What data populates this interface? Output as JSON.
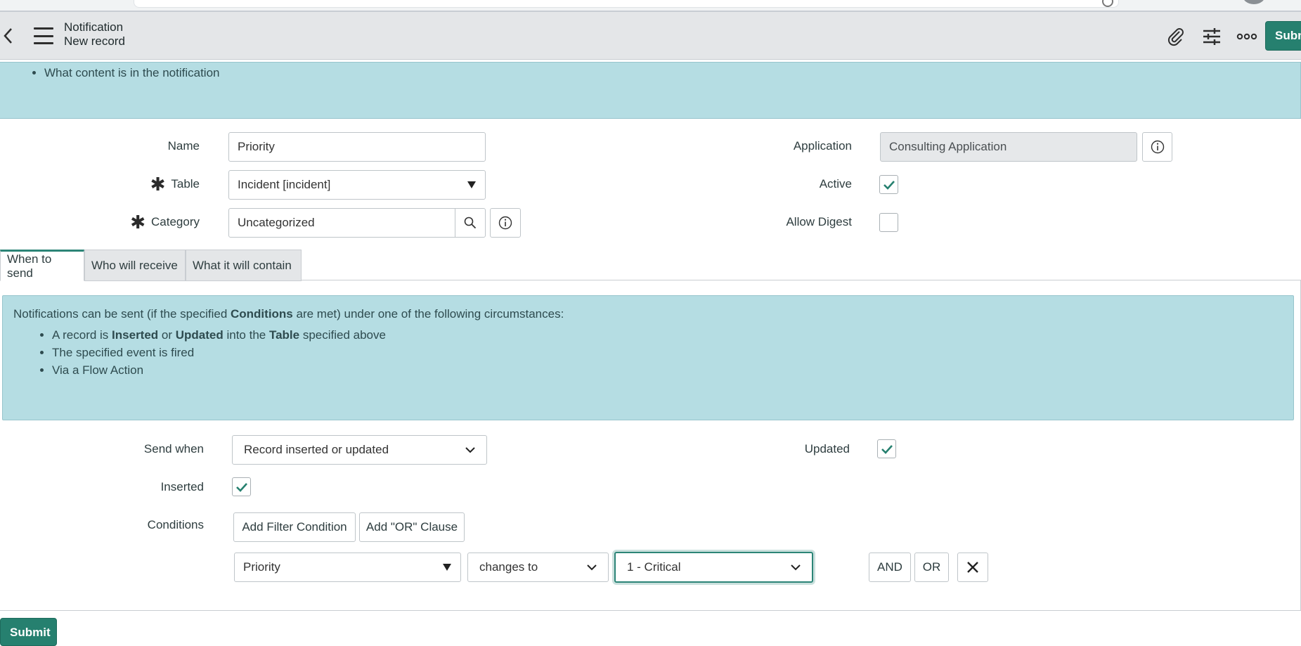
{
  "header": {
    "title": "Notification",
    "subtitle": "New record",
    "submit_label": "Subm"
  },
  "intro_banner": {
    "bullet": "What content is in the notification"
  },
  "form": {
    "name_label": "Name",
    "name_value": "Priority",
    "table_label": "Table",
    "table_value": "Incident [incident]",
    "category_label": "Category",
    "category_value": "Uncategorized",
    "application_label": "Application",
    "application_value": "Consulting Application",
    "active_label": "Active",
    "active_checked": true,
    "allow_digest_label": "Allow Digest",
    "allow_digest_checked": false
  },
  "tabs": [
    {
      "label": "When to send",
      "active": true
    },
    {
      "label": "Who will receive",
      "active": false
    },
    {
      "label": "What it will contain",
      "active": false
    }
  ],
  "when_banner": {
    "intro_pre": "Notifications can be sent (if the specified ",
    "intro_bold": "Conditions",
    "intro_post": " are met) under one of the following circumstances:",
    "bullet1_a": "A record is ",
    "bullet1_b": "Inserted",
    "bullet1_c": " or ",
    "bullet1_d": "Updated",
    "bullet1_e": " into the ",
    "bullet1_f": "Table",
    "bullet1_g": " specified above",
    "bullet2": "The specified event is fired",
    "bullet3": "Via a Flow Action"
  },
  "send": {
    "send_when_label": "Send when",
    "send_when_value": "Record inserted or updated",
    "updated_label": "Updated",
    "updated_checked": true,
    "inserted_label": "Inserted",
    "inserted_checked": true,
    "conditions_label": "Conditions",
    "add_filter_label": "Add Filter Condition",
    "add_or_label": "Add \"OR\" Clause",
    "cond_field": "Priority",
    "cond_operator": "changes to",
    "cond_value": "1 - Critical",
    "and_label": "AND",
    "or_label": "OR"
  },
  "footer": {
    "submit_label": "Submit"
  },
  "colors": {
    "accent": "#26806f",
    "info_bg": "#b5dde3",
    "header_bg": "#e4e6e8"
  }
}
